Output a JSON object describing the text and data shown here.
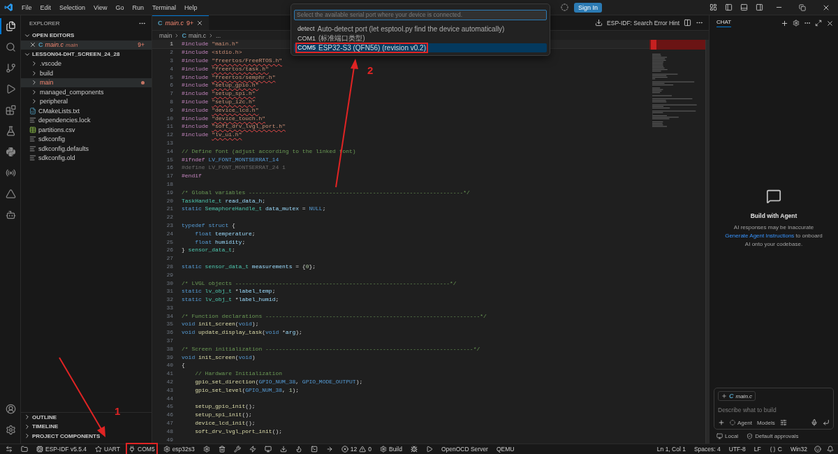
{
  "title_bar": {
    "menu": [
      "File",
      "Edit",
      "Selection",
      "View",
      "Go",
      "Run",
      "Terminal",
      "Help"
    ],
    "sign_in": "Sign In"
  },
  "quick_pick": {
    "placeholder": "Select the available serial port where your device is connected.",
    "items": [
      {
        "label": "detect",
        "description": "Auto-detect port (let esptool.py find the device automatically)",
        "selected": false,
        "highlighted": false
      },
      {
        "label": "COM1",
        "description": "(标准端口类型)",
        "selected": false,
        "highlighted": false
      },
      {
        "label": "COM5",
        "description": "ESP32-S3 (QFN56) (revision v0.2)",
        "selected": true,
        "highlighted": true
      }
    ]
  },
  "sidebar": {
    "title": "EXPLORER",
    "open_editors": {
      "label": "OPEN EDITORS",
      "expanded": true,
      "items": [
        {
          "file_icon": "C",
          "name": "main.c",
          "folder": "main",
          "badge": "9+",
          "has_errors": true
        }
      ]
    },
    "project": {
      "label": "LESSON04-DHT_SCREEN_24_28",
      "expanded": true,
      "children": [
        {
          "name": ".vscode",
          "kind": "folder",
          "expanded": false,
          "selected": false,
          "has_errors": false
        },
        {
          "name": "build",
          "kind": "folder",
          "expanded": false,
          "selected": false,
          "has_errors": false
        },
        {
          "name": "main",
          "kind": "folder",
          "expanded": false,
          "selected": true,
          "has_errors": true
        },
        {
          "name": "managed_components",
          "kind": "folder",
          "expanded": false,
          "selected": false,
          "has_errors": false
        },
        {
          "name": "peripheral",
          "kind": "folder",
          "expanded": false,
          "selected": false,
          "has_errors": false
        },
        {
          "name": "CMakeLists.txt",
          "kind": "cmake",
          "selected": false,
          "has_errors": false
        },
        {
          "name": "dependencies.lock",
          "kind": "text",
          "selected": false,
          "has_errors": false
        },
        {
          "name": "partitions.csv",
          "kind": "table",
          "selected": false,
          "has_errors": false
        },
        {
          "name": "sdkconfig",
          "kind": "text",
          "selected": false,
          "has_errors": false
        },
        {
          "name": "sdkconfig.defaults",
          "kind": "text",
          "selected": false,
          "has_errors": false
        },
        {
          "name": "sdkconfig.old",
          "kind": "text",
          "selected": false,
          "has_errors": false
        }
      ]
    },
    "sections": [
      {
        "label": "OUTLINE",
        "expanded": false
      },
      {
        "label": "TIMELINE",
        "expanded": false
      },
      {
        "label": "PROJECT COMPONENTS",
        "expanded": false
      }
    ]
  },
  "editor": {
    "tabs": [
      {
        "file_icon": "C",
        "name": "main.c",
        "badge": "9+",
        "selected": true,
        "has_errors": true
      }
    ],
    "breadcrumbs": [
      {
        "text": "main"
      },
      {
        "text": "main.c",
        "file_icon": "C"
      },
      {
        "text": "..."
      }
    ],
    "action": "ESP-IDF: Search Error Hint",
    "lines": [
      {
        "number": "1",
        "current": true,
        "segments": [
          {
            "text": "#include ",
            "kind": "directive"
          },
          {
            "text": "\"main.h\"",
            "kind": "string"
          }
        ]
      },
      {
        "number": "2",
        "current": false,
        "segments": [
          {
            "text": "#include ",
            "kind": "directive"
          },
          {
            "text": "<stdio.h>",
            "kind": "string"
          }
        ]
      },
      {
        "number": "3",
        "current": false,
        "segments": [
          {
            "text": "#include ",
            "kind": "directive"
          },
          {
            "text": "\"freertos/FreeRTOS.h\"",
            "kind": "squiggle"
          }
        ]
      },
      {
        "number": "4",
        "current": false,
        "segments": [
          {
            "text": "#include ",
            "kind": "directive"
          },
          {
            "text": "\"freertos/task.h\"",
            "kind": "squiggle"
          }
        ]
      },
      {
        "number": "5",
        "current": false,
        "segments": [
          {
            "text": "#include ",
            "kind": "directive"
          },
          {
            "text": "\"freertos/semphr.h\"",
            "kind": "squiggle"
          }
        ]
      },
      {
        "number": "6",
        "current": false,
        "segments": [
          {
            "text": "#include ",
            "kind": "directive"
          },
          {
            "text": "\"setup_gpio.h\"",
            "kind": "squiggle"
          }
        ]
      },
      {
        "number": "7",
        "current": false,
        "segments": [
          {
            "text": "#include ",
            "kind": "directive"
          },
          {
            "text": "\"setup_spi.h\"",
            "kind": "squiggle"
          }
        ]
      },
      {
        "number": "8",
        "current": false,
        "segments": [
          {
            "text": "#include ",
            "kind": "directive"
          },
          {
            "text": "\"setup_i2c.h\"",
            "kind": "squiggle"
          }
        ]
      },
      {
        "number": "9",
        "current": false,
        "segments": [
          {
            "text": "#include ",
            "kind": "directive"
          },
          {
            "text": "\"device_lcd.h\"",
            "kind": "squiggle"
          }
        ]
      },
      {
        "number": "10",
        "current": false,
        "segments": [
          {
            "text": "#include ",
            "kind": "directive"
          },
          {
            "text": "\"device_touch.h\"",
            "kind": "squiggle"
          }
        ]
      },
      {
        "number": "11",
        "current": false,
        "segments": [
          {
            "text": "#include ",
            "kind": "directive"
          },
          {
            "text": "\"soft_drv_lvgl_port.h\"",
            "kind": "squiggle"
          }
        ]
      },
      {
        "number": "12",
        "current": false,
        "segments": [
          {
            "text": "#include ",
            "kind": "directive"
          },
          {
            "text": "\"lv_ui.h\"",
            "kind": "squiggle"
          }
        ]
      },
      {
        "number": "13",
        "current": false
      },
      {
        "number": "14",
        "current": false,
        "segments": [
          {
            "text": "// Define font (adjust according to the linked font)",
            "kind": "comment"
          }
        ]
      },
      {
        "number": "15",
        "current": false,
        "segments": [
          {
            "text": "#ifndef ",
            "kind": "directive"
          },
          {
            "text": "LV_FONT_MONTSERRAT_14",
            "kind": "macro"
          }
        ]
      },
      {
        "number": "16",
        "current": false,
        "segments": [
          {
            "text": "#define LV_FONT_MONTSERRAT_24 1",
            "kind": "inactive"
          }
        ]
      },
      {
        "number": "17",
        "current": false,
        "segments": [
          {
            "text": "#endif",
            "kind": "directive"
          }
        ]
      },
      {
        "number": "18",
        "current": false
      },
      {
        "number": "19",
        "current": false,
        "segments": [
          {
            "text": "/* Global variables ----------------------------------------------------------------*/",
            "kind": "comment"
          }
        ]
      },
      {
        "number": "20",
        "current": false,
        "segments": [
          {
            "text": "TaskHandle_t ",
            "kind": "type"
          },
          {
            "text": "read_data_h",
            "kind": "variable"
          },
          {
            "text": ";",
            "kind": "plain"
          }
        ]
      },
      {
        "number": "21",
        "current": false,
        "segments": [
          {
            "text": "static ",
            "kind": "keyword"
          },
          {
            "text": "SemaphoreHandle_t ",
            "kind": "type"
          },
          {
            "text": "data_mutex",
            "kind": "variable"
          },
          {
            "text": " = ",
            "kind": "plain"
          },
          {
            "text": "NULL",
            "kind": "macro"
          },
          {
            "text": ";",
            "kind": "plain"
          }
        ]
      },
      {
        "number": "22",
        "current": false
      },
      {
        "number": "23",
        "current": false,
        "segments": [
          {
            "text": "typedef struct",
            "kind": "keyword"
          },
          {
            "text": " {",
            "kind": "plain"
          }
        ]
      },
      {
        "number": "24",
        "current": false,
        "segments": [
          {
            "text": "    float ",
            "kind": "keyword"
          },
          {
            "text": "temperature",
            "kind": "variable"
          },
          {
            "text": ";",
            "kind": "plain"
          }
        ]
      },
      {
        "number": "25",
        "current": false,
        "segments": [
          {
            "text": "    float ",
            "kind": "keyword"
          },
          {
            "text": "humidity",
            "kind": "variable"
          },
          {
            "text": ";",
            "kind": "plain"
          }
        ]
      },
      {
        "number": "26",
        "current": false,
        "segments": [
          {
            "text": "} ",
            "kind": "plain"
          },
          {
            "text": "sensor_data_t",
            "kind": "type"
          },
          {
            "text": ";",
            "kind": "plain"
          }
        ]
      },
      {
        "number": "27",
        "current": false
      },
      {
        "number": "28",
        "current": false,
        "segments": [
          {
            "text": "static ",
            "kind": "keyword"
          },
          {
            "text": "sensor_data_t ",
            "kind": "type"
          },
          {
            "text": "measurements",
            "kind": "variable"
          },
          {
            "text": " = {",
            "kind": "plain"
          },
          {
            "text": "0",
            "kind": "number"
          },
          {
            "text": "};",
            "kind": "plain"
          }
        ]
      },
      {
        "number": "29",
        "current": false
      },
      {
        "number": "30",
        "current": false,
        "segments": [
          {
            "text": "/* LVGL objects ----------------------------------------------------------------*/",
            "kind": "comment"
          }
        ]
      },
      {
        "number": "31",
        "current": false,
        "segments": [
          {
            "text": "static ",
            "kind": "keyword"
          },
          {
            "text": "lv_obj_t",
            "kind": "type"
          },
          {
            "text": " *",
            "kind": "plain"
          },
          {
            "text": "label_temp",
            "kind": "variable"
          },
          {
            "text": ";",
            "kind": "plain"
          }
        ]
      },
      {
        "number": "32",
        "current": false,
        "segments": [
          {
            "text": "static ",
            "kind": "keyword"
          },
          {
            "text": "lv_obj_t",
            "kind": "type"
          },
          {
            "text": " *",
            "kind": "plain"
          },
          {
            "text": "label_humid",
            "kind": "variable"
          },
          {
            "text": ";",
            "kind": "plain"
          }
        ]
      },
      {
        "number": "33",
        "current": false
      },
      {
        "number": "34",
        "current": false,
        "segments": [
          {
            "text": "/* Function declarations ----------------------------------------------------------------*/",
            "kind": "comment"
          }
        ]
      },
      {
        "number": "35",
        "current": false,
        "segments": [
          {
            "text": "void ",
            "kind": "keyword"
          },
          {
            "text": "init_screen",
            "kind": "function"
          },
          {
            "text": "(",
            "kind": "plain"
          },
          {
            "text": "void",
            "kind": "keyword"
          },
          {
            "text": ");",
            "kind": "plain"
          }
        ]
      },
      {
        "number": "36",
        "current": false,
        "segments": [
          {
            "text": "void ",
            "kind": "keyword"
          },
          {
            "text": "update_display_task",
            "kind": "function"
          },
          {
            "text": "(",
            "kind": "plain"
          },
          {
            "text": "void",
            "kind": "keyword"
          },
          {
            "text": " *",
            "kind": "plain"
          },
          {
            "text": "arg",
            "kind": "variable"
          },
          {
            "text": ");",
            "kind": "plain"
          }
        ]
      },
      {
        "number": "37",
        "current": false
      },
      {
        "number": "38",
        "current": false,
        "segments": [
          {
            "text": "/* Screen initialization --------------------------------------------------------------*/",
            "kind": "comment"
          }
        ]
      },
      {
        "number": "39",
        "current": false,
        "segments": [
          {
            "text": "void ",
            "kind": "keyword"
          },
          {
            "text": "init_screen",
            "kind": "function"
          },
          {
            "text": "(",
            "kind": "plain"
          },
          {
            "text": "void",
            "kind": "keyword"
          },
          {
            "text": ")",
            "kind": "plain"
          }
        ]
      },
      {
        "number": "40",
        "current": false,
        "segments": [
          {
            "text": "{",
            "kind": "plain"
          }
        ]
      },
      {
        "number": "41",
        "current": false,
        "segments": [
          {
            "text": "    // Hardware Initialization",
            "kind": "comment"
          }
        ]
      },
      {
        "number": "42",
        "current": false,
        "segments": [
          {
            "text": "    gpio_set_direction",
            "kind": "function"
          },
          {
            "text": "(",
            "kind": "plain"
          },
          {
            "text": "GPIO_NUM_38",
            "kind": "macro"
          },
          {
            "text": ", ",
            "kind": "plain"
          },
          {
            "text": "GPIO_MODE_OUTPUT",
            "kind": "macro"
          },
          {
            "text": ");",
            "kind": "plain"
          }
        ]
      },
      {
        "number": "43",
        "current": false,
        "segments": [
          {
            "text": "    gpio_set_level",
            "kind": "function"
          },
          {
            "text": "(",
            "kind": "plain"
          },
          {
            "text": "GPIO_NUM_38",
            "kind": "macro"
          },
          {
            "text": ", ",
            "kind": "plain"
          },
          {
            "text": "1",
            "kind": "number"
          },
          {
            "text": ");",
            "kind": "plain"
          }
        ]
      },
      {
        "number": "44",
        "current": false
      },
      {
        "number": "45",
        "current": false,
        "segments": [
          {
            "text": "    setup_gpio_init",
            "kind": "function"
          },
          {
            "text": "();",
            "kind": "plain"
          }
        ]
      },
      {
        "number": "46",
        "current": false,
        "segments": [
          {
            "text": "    setup_spi_init",
            "kind": "function"
          },
          {
            "text": "();",
            "kind": "plain"
          }
        ]
      },
      {
        "number": "47",
        "current": false,
        "segments": [
          {
            "text": "    device_lcd_init",
            "kind": "function"
          },
          {
            "text": "();",
            "kind": "plain"
          }
        ]
      },
      {
        "number": "48",
        "current": false,
        "segments": [
          {
            "text": "    soft_drv_lvgl_port_init",
            "kind": "function"
          },
          {
            "text": "();",
            "kind": "plain"
          }
        ]
      },
      {
        "number": "49",
        "current": false
      }
    ]
  },
  "chat": {
    "title": "CHAT",
    "heading": "Build with Agent",
    "note": "AI responses may be inaccurate",
    "link": "Generate Agent Instructions",
    "link_tail": " to onboard AI onto your codebase.",
    "attachment": {
      "file_icon": "C",
      "name": "main.c"
    },
    "placeholder": "Describe what to build",
    "mode": "Agent",
    "models": "Models",
    "footer": [
      "Local",
      "Default approvals"
    ]
  },
  "status_bar": {
    "left": [
      {
        "kind": "icon"
      },
      {
        "kind": "icon"
      },
      {
        "kind": "labeled",
        "text": "ESP-IDF v5.5.4",
        "highlighted": false
      },
      {
        "kind": "labeled",
        "text": "UART",
        "highlighted": false
      },
      {
        "kind": "labeled",
        "text": "COM5",
        "highlighted": true
      },
      {
        "kind": "labeled",
        "text": "esp32s3",
        "highlighted": false
      },
      {
        "kind": "icon"
      },
      {
        "kind": "icon"
      },
      {
        "kind": "icon"
      },
      {
        "kind": "icon"
      },
      {
        "kind": "icon"
      },
      {
        "kind": "icon"
      },
      {
        "kind": "icon"
      },
      {
        "kind": "icon"
      },
      {
        "kind": "icon"
      },
      {
        "kind": "problems",
        "errors": "12",
        "warnings": "0"
      },
      {
        "kind": "labeled",
        "text": "Build",
        "highlighted": false
      },
      {
        "kind": "icon"
      },
      {
        "kind": "icon"
      },
      {
        "kind": "text",
        "text": "OpenOCD Server"
      },
      {
        "kind": "text",
        "text": "QEMU"
      }
    ],
    "right": [
      "Ln 1, Col 1",
      "Spaces: 4",
      "UTF-8",
      "LF",
      "C",
      "Win32"
    ]
  },
  "annotations": [
    {
      "label": "1"
    },
    {
      "label": "2"
    }
  ]
}
